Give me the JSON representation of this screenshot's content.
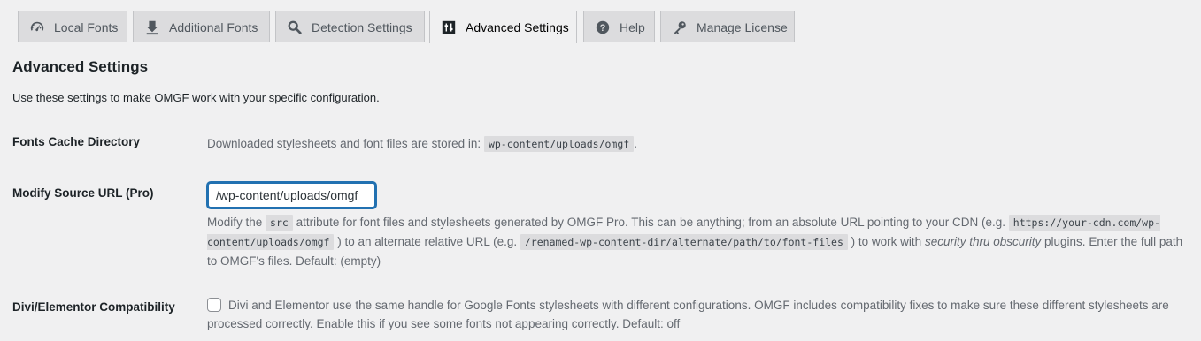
{
  "tabs": [
    {
      "label": "Local Fonts",
      "icon": "dashboard-icon"
    },
    {
      "label": "Additional Fonts",
      "icon": "download-icon"
    },
    {
      "label": "Detection Settings",
      "icon": "search-icon"
    },
    {
      "label": "Advanced Settings",
      "icon": "admin-generic-icon"
    },
    {
      "label": "Help",
      "icon": "help-icon"
    },
    {
      "label": "Manage License",
      "icon": "key-icon"
    }
  ],
  "page": {
    "title": "Advanced Settings",
    "intro": "Use these settings to make OMGF work with your specific configuration."
  },
  "fonts_cache": {
    "label": "Fonts Cache Directory",
    "text_before": "Downloaded stylesheets and font files are stored in:",
    "code": "wp-content/uploads/omgf",
    "text_after": "."
  },
  "source_url": {
    "label": "Modify Source URL (Pro)",
    "value": "/wp-content/uploads/omgf",
    "d1": "Modify the",
    "c1": "src",
    "d2": "attribute for font files and stylesheets generated by OMGF Pro. This can be anything; from an absolute URL pointing to your CDN (e.g.",
    "c2": "https://your-cdn.com/wp-content/uploads/omgf",
    "d3": ") to an alternate relative URL (e.g.",
    "c3": "/renamed-wp-content-dir/alternate/path/to/font-files",
    "d4": ") to work with",
    "d5": "security thru obscurity",
    "d6": "plugins. Enter the full path to OMGF's files. Default: (empty)"
  },
  "compat": {
    "label": "Divi/Elementor Compatibility",
    "checked": false,
    "text": "Divi and Elementor use the same handle for Google Fonts stylesheets with different configurations. OMGF includes compatibility fixes to make sure these different stylesheets are processed correctly. Enable this if you see some fonts not appearing correctly. Default: off"
  }
}
